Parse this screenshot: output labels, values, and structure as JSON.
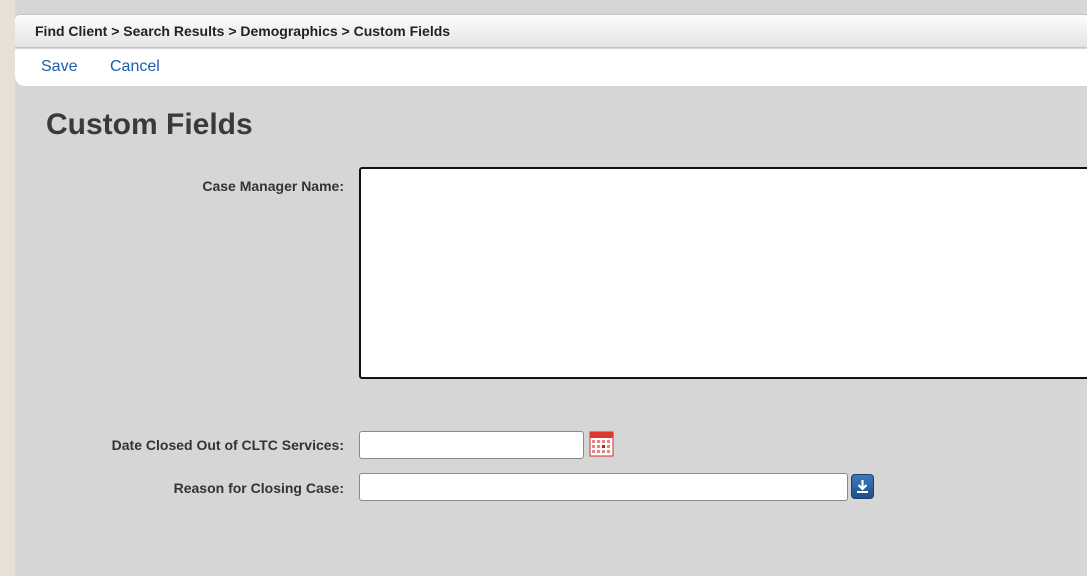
{
  "breadcrumb": "Find Client > Search Results > Demographics > Custom Fields",
  "toolbar": {
    "save_label": "Save",
    "cancel_label": "Cancel"
  },
  "page_title": "Custom Fields",
  "fields": {
    "case_manager": {
      "label": "Case Manager Name:",
      "value": ""
    },
    "date_closed": {
      "label": "Date Closed Out of CLTC Services:",
      "value": ""
    },
    "reason": {
      "label": "Reason for Closing Case:",
      "value": ""
    }
  },
  "icons": {
    "calendar": "calendar-icon",
    "dropdown": "download-arrow-icon"
  },
  "colors": {
    "link": "#1a5dab",
    "background": "#d6d6d6",
    "calendar_red": "#e0342c",
    "dropdown_blue": "#2a64a3"
  }
}
